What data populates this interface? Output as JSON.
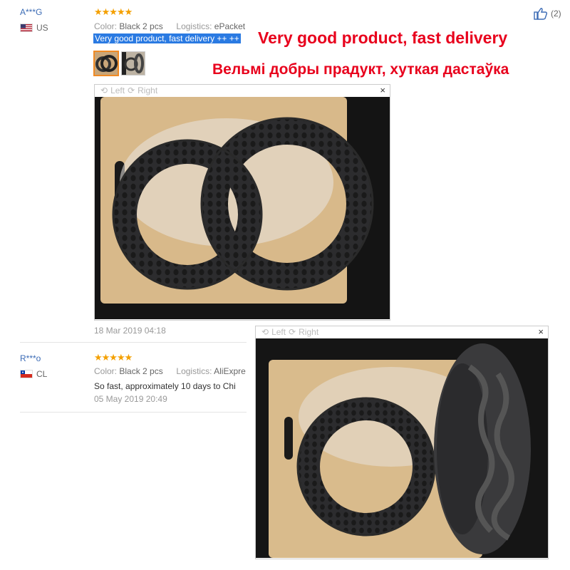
{
  "reviews": [
    {
      "user": "A***G",
      "country": "US",
      "stars": "★★★★★",
      "color_label": "Color:",
      "color_value": "Black 2 pcs",
      "logistics_label": "Logistics:",
      "logistics_value": "ePacket",
      "text": "Very good product, fast delivery ++ ++",
      "date": "18 Mar 2019 04:18",
      "helpful_count": "(2)"
    },
    {
      "user": "R***o",
      "country": "CL",
      "stars": "★★★★★",
      "color_label": "Color:",
      "color_value": "Black 2 pcs",
      "logistics_label": "Logistics:",
      "logistics_value": "AliExpre",
      "text": "So fast, approximately 10 days to Chi",
      "date": "05 May 2019 20:49"
    }
  ],
  "annotations": {
    "line1": "Very good product, fast delivery",
    "line2": "Вельмі добры прадукт, хуткая дастаўка"
  },
  "viewer": {
    "left_label": "Left",
    "right_label": "Right",
    "close_label": "×"
  },
  "colors": {
    "accent": "#2a7ae2",
    "annotation": "#e8001c",
    "stars": "#f4a000"
  }
}
